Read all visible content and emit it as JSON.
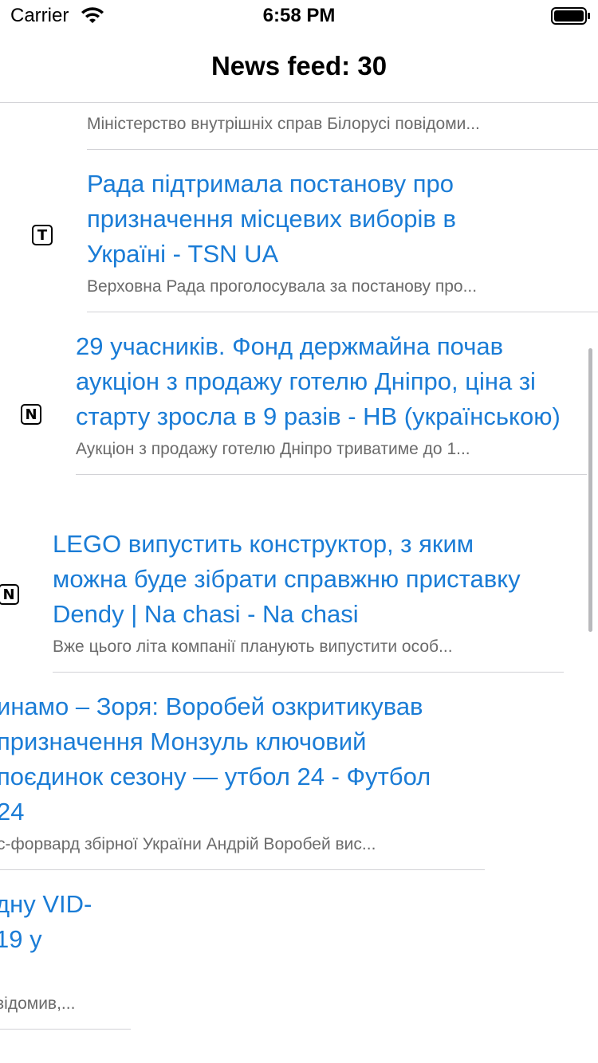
{
  "status_bar": {
    "carrier": "Carrier",
    "time": "6:58 PM"
  },
  "nav": {
    "title": "News feed: 30"
  },
  "feed": {
    "items": [
      {
        "title": "",
        "summary": "Міністерство внутрішніх справ Білорусі повідоми..."
      },
      {
        "source_badge": "T",
        "title": "Рада підтримала постанову про призначення місцевих виборів в Україні - TSN UA",
        "summary": "Верховна Рада проголосувала за постанову про..."
      },
      {
        "source_badge": "N",
        "title": "29 учасників. Фонд держмайна почав аукціон з продажу готелю Дніпро, ціна зі старту зросла в 9 разів - НВ (українською)",
        "summary": "Аукціон з продажу готелю Дніпро триватиме до 1..."
      },
      {
        "source_badge": "N",
        "title": "LEGO випустить конструктор, з яким можна буде зібрати справжню приставку Dendy | Na chasi - Na chasi",
        "summary": "Вже цього літа компанії планують випустити особ..."
      },
      {
        "title": "инамо – Зоря: Воробей озкритикував призначення Монзуль ключовий поєдинок сезону — утбол 24 - Футбол 24",
        "summary": "с-форвард збірної України Андрій Воробей вис..."
      },
      {
        "title": "дну VID-19 у",
        "summary": "відомив,..."
      }
    ]
  }
}
